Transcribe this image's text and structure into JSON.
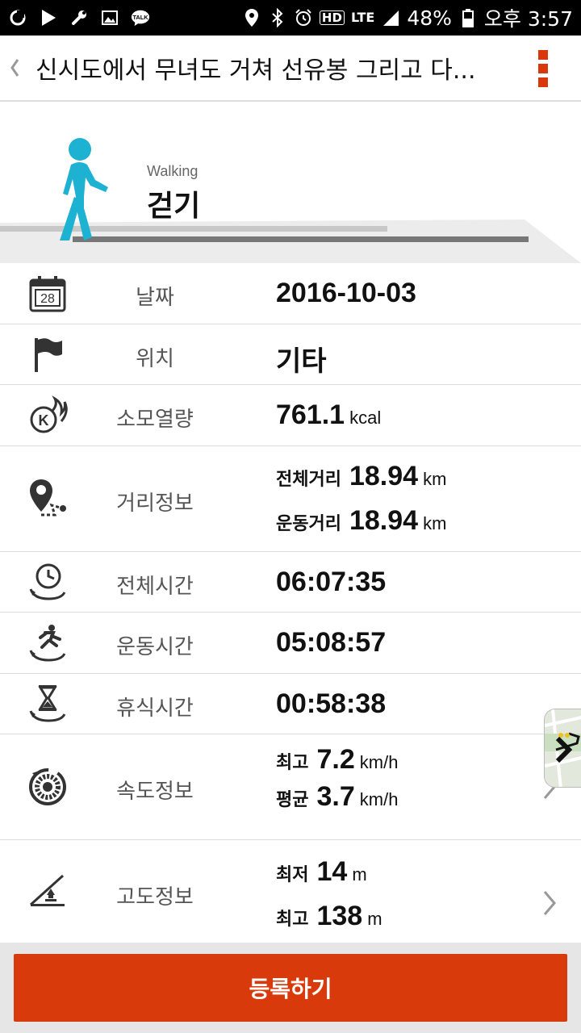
{
  "status_bar": {
    "hd": "HD",
    "lte": "LTE",
    "battery": "48%",
    "time": "오후 3:57",
    "talk": "TALK"
  },
  "app_bar": {
    "title": "신시도에서 무녀도 거쳐 선유봉 그리고 다..."
  },
  "activity": {
    "name_en": "Walking",
    "name_ko": "걷기",
    "accent_color": "#1eb2d2"
  },
  "calendar_icon_text": "28",
  "rows": {
    "date": {
      "label": "날짜",
      "value": "2016-10-03"
    },
    "location": {
      "label": "위치",
      "value": "기타"
    },
    "calories": {
      "label": "소모열량",
      "value": "761.1",
      "unit": "kcal",
      "icon_text": "K"
    },
    "distance": {
      "label": "거리정보",
      "total_label": "전체거리",
      "total_value": "18.94",
      "total_unit": "km",
      "exercise_label": "운동거리",
      "exercise_value": "18.94",
      "exercise_unit": "km"
    },
    "total_time": {
      "label": "전체시간",
      "value": "06:07:35"
    },
    "exercise_time": {
      "label": "운동시간",
      "value": "05:08:57"
    },
    "rest_time": {
      "label": "휴식시간",
      "value": "00:58:38"
    },
    "speed": {
      "label": "속도정보",
      "max_label": "최고",
      "max_value": "7.2",
      "max_unit": "km/h",
      "avg_label": "평균",
      "avg_value": "3.7",
      "avg_unit": "km/h"
    },
    "altitude": {
      "label": "고도정보",
      "min_label": "최저",
      "min_value": "14",
      "min_unit": "m",
      "max_label": "최고",
      "max_value": "138",
      "max_unit": "m"
    }
  },
  "register_button": "등록하기",
  "colors": {
    "primary": "#d93a0b"
  }
}
